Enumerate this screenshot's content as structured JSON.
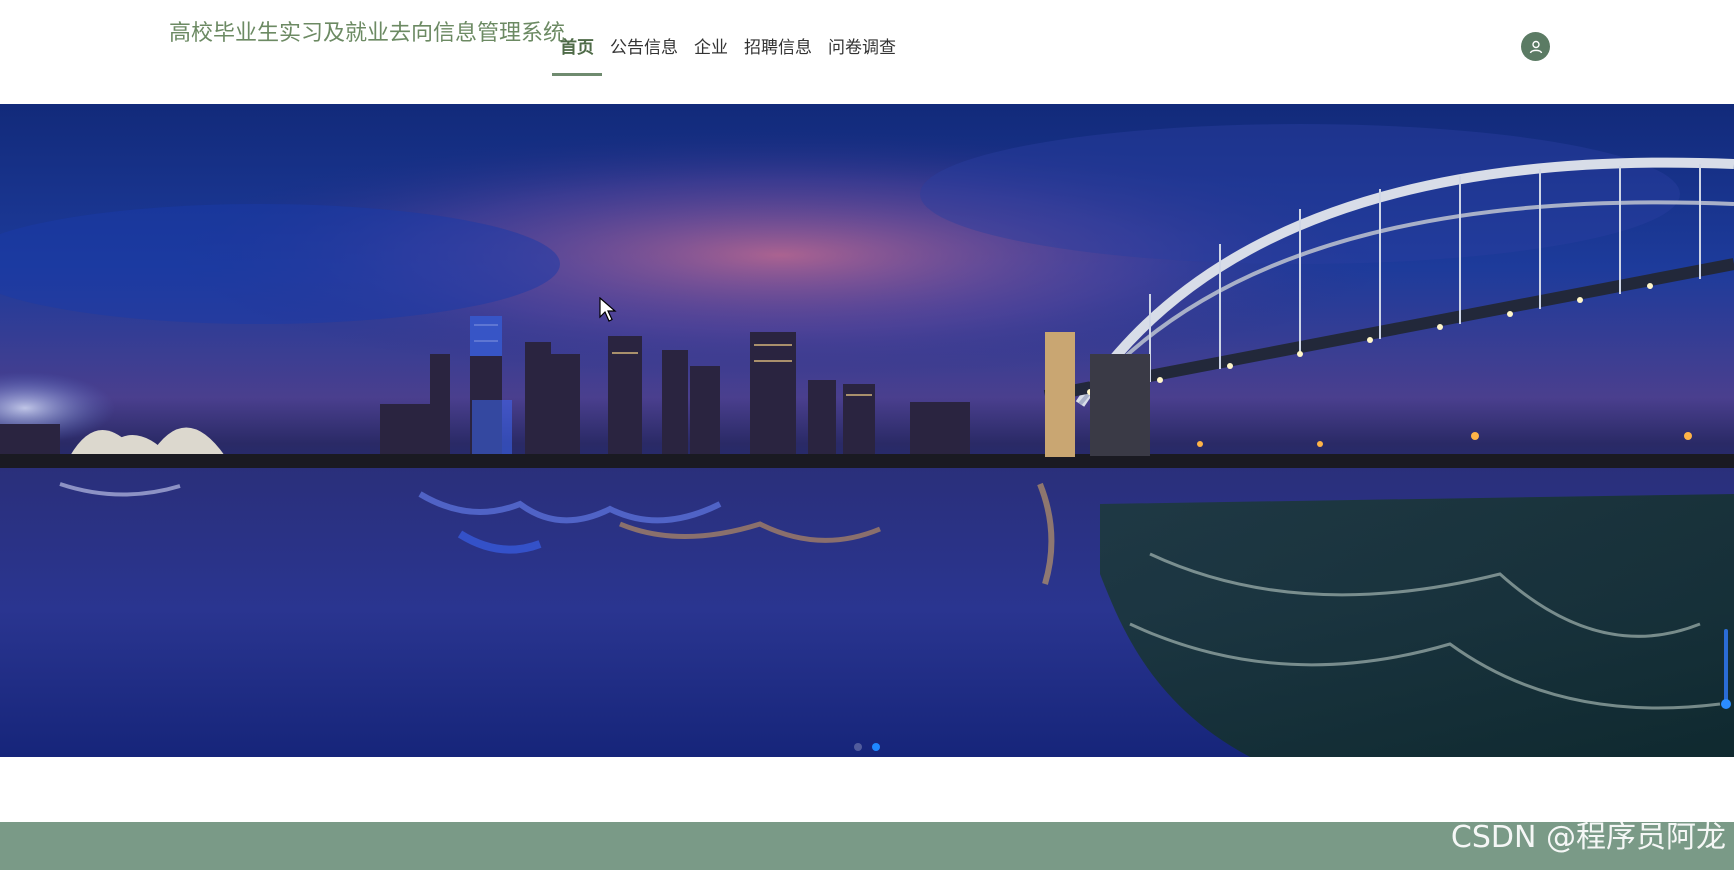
{
  "header": {
    "site_title": "高校毕业生实习及就业去向信息管理系统",
    "nav": [
      {
        "label": "首页",
        "active": true
      },
      {
        "label": "公告信息",
        "active": false
      },
      {
        "label": "企业",
        "active": false
      },
      {
        "label": "招聘信息",
        "active": false
      },
      {
        "label": "问卷调查",
        "active": false
      }
    ],
    "user_icon": "user-icon"
  },
  "banner": {
    "slides_total": 2,
    "active_slide": 2
  },
  "footer": {
    "watermark": "CSDN @程序员阿龙"
  },
  "colors": {
    "title_green": "#6c8a63",
    "nav_active_underline": "#6f8b6f",
    "footer_bg": "#7a9a87",
    "dot_active": "#1e88ff"
  }
}
